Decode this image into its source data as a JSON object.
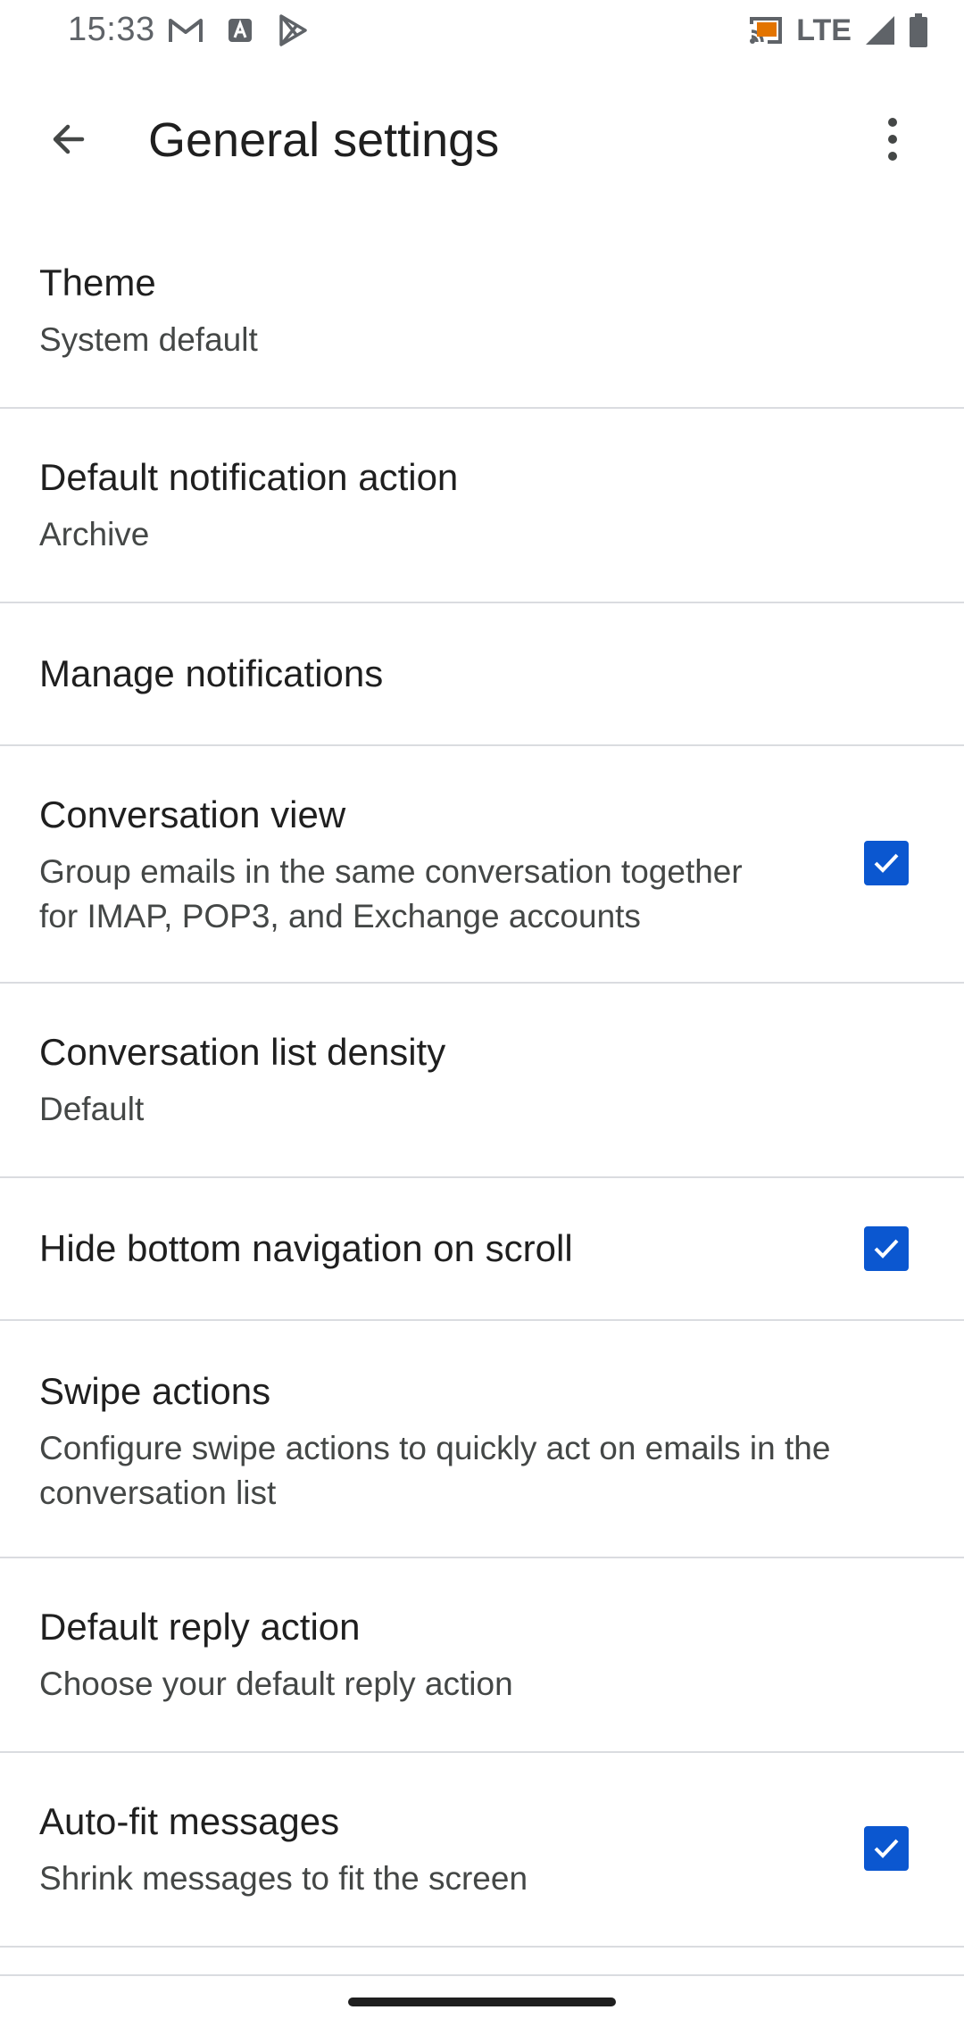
{
  "status_bar": {
    "time": "15:33",
    "network": "LTE",
    "left_icons": [
      "gmail-icon",
      "text-a-icon",
      "play-store-icon"
    ],
    "right_icons": [
      "cast-icon",
      "signal-icon",
      "battery-icon"
    ]
  },
  "app_bar": {
    "title": "General settings",
    "back_icon": "arrow-back-icon",
    "overflow_icon": "more-vert-icon"
  },
  "settings": [
    {
      "title": "Theme",
      "subtitle": "System default"
    },
    {
      "title": "Default notification action",
      "subtitle": "Archive"
    },
    {
      "title": "Manage notifications"
    },
    {
      "title": "Conversation view",
      "subtitle_line1": "Group emails in the same conversation together",
      "subtitle_line2": "for IMAP, POP3, and Exchange accounts",
      "checked": true
    },
    {
      "title": "Conversation list density",
      "subtitle": "Default"
    },
    {
      "title": "Hide bottom navigation on scroll",
      "checked": true
    },
    {
      "title": "Swipe actions",
      "subtitle_line1": "Configure swipe actions to quickly act on emails in the",
      "subtitle_line2": "conversation list"
    },
    {
      "title": "Default reply action",
      "subtitle": "Choose your default reply action"
    },
    {
      "title": "Auto-fit messages",
      "subtitle": "Shrink messages to fit the screen",
      "checked": true
    }
  ],
  "colors": {
    "checkbox": "#0b57d0",
    "divider": "#dadce0",
    "title_text": "#1f1f1f",
    "subtitle_text": "#444746"
  }
}
